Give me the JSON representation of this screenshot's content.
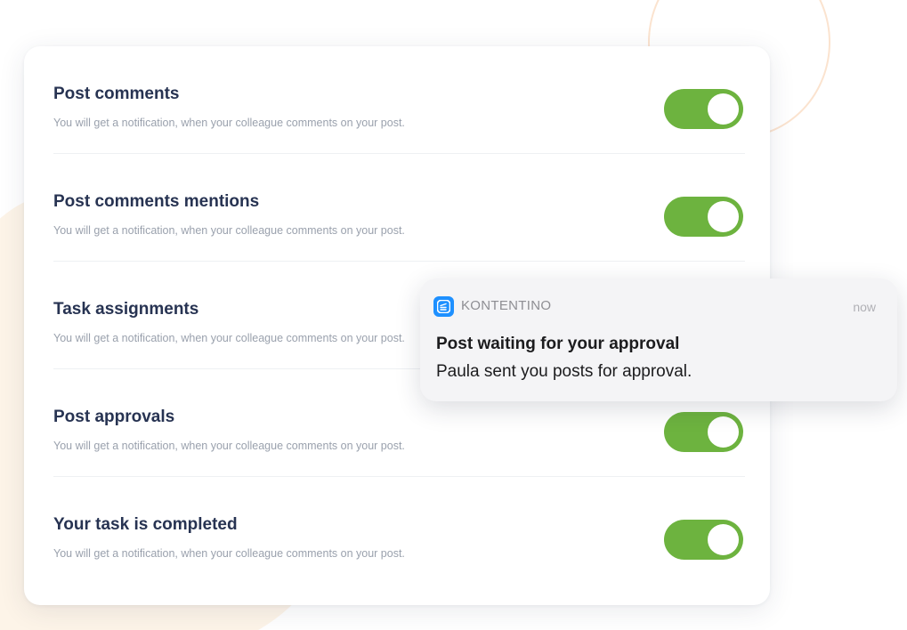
{
  "colors": {
    "toggle_on": "#6db33f",
    "title": "#273352",
    "description": "#9aa1ad",
    "app_icon": "#1e90ff"
  },
  "settings": [
    {
      "title": "Post comments",
      "description": "You will get a notification, when your colleague comments on your post.",
      "enabled": true
    },
    {
      "title": "Post comments mentions",
      "description": "You will get a notification, when your colleague comments on your post.",
      "enabled": true
    },
    {
      "title": "Task assignments",
      "description": "You will get a notification, when your colleague comments on your post.",
      "enabled": true
    },
    {
      "title": "Post approvals",
      "description": "You will get a notification, when your colleague comments on your post.",
      "enabled": true
    },
    {
      "title": "Your task is completed",
      "description": "You will get a notification, when your colleague comments on your post.",
      "enabled": true
    }
  ],
  "notification": {
    "app_icon": "kontentino-app-icon",
    "app_name": "KONTENTINO",
    "time": "now",
    "title": "Post waiting for your approval",
    "body": "Paula sent you posts for approval."
  }
}
